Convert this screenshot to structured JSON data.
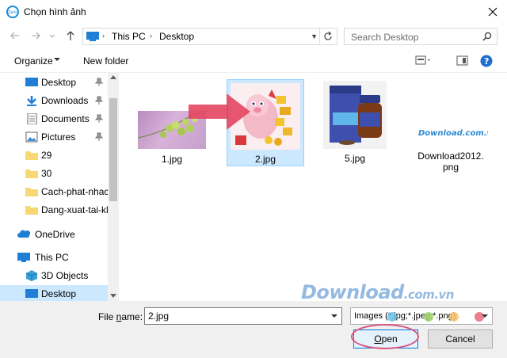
{
  "window": {
    "title": "Chọn hình ảnh",
    "app_icon_text": "Zalo"
  },
  "address": {
    "crumbs": [
      "This PC",
      "Desktop"
    ]
  },
  "search": {
    "placeholder": "Search Desktop"
  },
  "toolbar": {
    "organize_label": "Organize",
    "new_folder_label": "New folder"
  },
  "nav": {
    "items": [
      {
        "label": "Desktop",
        "icon": "desktop-icon",
        "pinned": true
      },
      {
        "label": "Downloads",
        "icon": "download-icon",
        "pinned": true
      },
      {
        "label": "Documents",
        "icon": "documents-icon",
        "pinned": true
      },
      {
        "label": "Pictures",
        "icon": "pictures-icon",
        "pinned": true
      },
      {
        "label": "29",
        "icon": "folder-icon"
      },
      {
        "label": "30",
        "icon": "folder-icon"
      },
      {
        "label": "Cach-phat-nhac",
        "icon": "folder-icon"
      },
      {
        "label": "Dang-xuat-tai-kl",
        "icon": "folder-icon"
      },
      {
        "label": "OneDrive",
        "icon": "onedrive-icon"
      },
      {
        "label": "This PC",
        "icon": "this-pc-icon"
      },
      {
        "label": "3D Objects",
        "icon": "3d-objects-icon"
      },
      {
        "label": "Desktop",
        "icon": "desktop-icon",
        "selected": true
      }
    ]
  },
  "files": [
    {
      "name": "1.jpg"
    },
    {
      "name": "2.jpg",
      "selected": true
    },
    {
      "name": "5.jpg"
    },
    {
      "name_line1": "Download2012.",
      "name_line2": "png",
      "thumb_text": "Download.com.vn"
    }
  ],
  "footer": {
    "file_name_label_pre": "File ",
    "file_name_label_ul": "n",
    "file_name_label_post": "ame:",
    "file_name_value": "2.jpg",
    "file_type_value": "Images (*.jpg;*.jpeg;*.png)",
    "open_label_ul": "O",
    "open_label_rest": "pen",
    "cancel_label": "Cancel"
  },
  "watermark": {
    "main": "Download",
    "sub": ".com.vn"
  },
  "colors": {
    "accent": "#0078d7",
    "selection": "#cce8ff",
    "highlight_ring": "#d9567d"
  }
}
